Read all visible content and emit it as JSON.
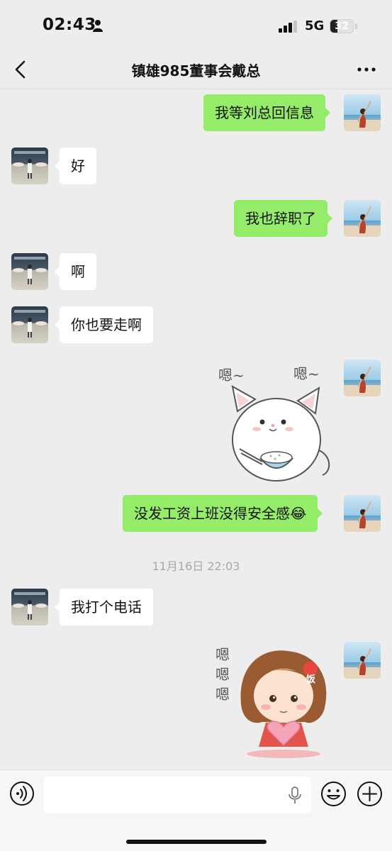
{
  "status_bar": {
    "time": "02:43",
    "network": "5G",
    "battery": "32",
    "battery_level_percent": 32
  },
  "nav": {
    "back_icon": "chevron-left-icon",
    "title": "镇雄985董事会戴总",
    "more_icon": "more-dots-icon"
  },
  "messages": [
    {
      "side": "out",
      "type": "text",
      "text": "我等刘总回信息"
    },
    {
      "side": "in",
      "type": "text",
      "text": "好"
    },
    {
      "side": "out",
      "type": "text",
      "text": "我也辞职了"
    },
    {
      "side": "in",
      "type": "text",
      "text": "啊"
    },
    {
      "side": "in",
      "type": "text",
      "text": "你也要走啊"
    },
    {
      "side": "out",
      "type": "sticker",
      "text": "嗯~ 嗯~",
      "sticker": "cat-with-rice-bowl",
      "label_1": "嗯~",
      "label_2": "嗯~"
    },
    {
      "side": "out",
      "type": "text",
      "text": "没发工资上班没得安全感",
      "emoji": "😂"
    },
    {
      "side": "in",
      "type": "text",
      "text": "我打个电话"
    },
    {
      "side": "out",
      "type": "sticker",
      "sticker": "girl-holding-heart",
      "label_1": "嗯",
      "label_2": "嗯",
      "label_3": "嗯",
      "badge": "饭"
    }
  ],
  "timestamp": "11月16日 22:03",
  "input_bar": {
    "voice_icon": "voice-wave-icon",
    "placeholder": "",
    "mic_icon": "microphone-icon",
    "emoji_icon": "emoji-face-icon",
    "plus_icon": "plus-circle-icon"
  },
  "colors": {
    "background": "#ededed",
    "outgoing_bubble": "#95ec69",
    "incoming_bubble": "#ffffff",
    "timestamp": "#a8a8a8"
  }
}
